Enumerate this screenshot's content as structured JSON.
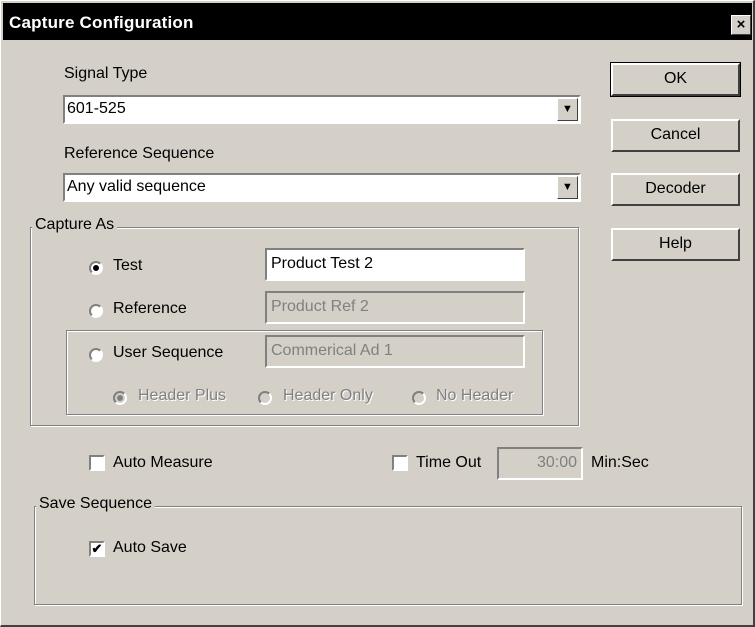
{
  "window": {
    "title": "Capture Configuration",
    "close_glyph": "×"
  },
  "signal_type": {
    "label": "Signal Type",
    "value": "601-525"
  },
  "reference_sequence": {
    "label": "Reference Sequence",
    "value": "Any valid sequence"
  },
  "dropdown_glyph": "▼",
  "buttons": {
    "ok": "OK",
    "cancel": "Cancel",
    "decoder": "Decoder",
    "help": "Help"
  },
  "capture_as": {
    "legend": "Capture As",
    "test": {
      "label": "Test",
      "value": "Product Test 2",
      "selected": true
    },
    "reference": {
      "label": "Reference",
      "value": "Product Ref 2",
      "selected": false
    },
    "user_sequence": {
      "label": "User Sequence",
      "value": "Commerical Ad 1",
      "selected": false
    },
    "header_options": [
      "Header Plus",
      "Header Only",
      "No Header"
    ]
  },
  "auto_measure": {
    "label": "Auto Measure",
    "checked": false
  },
  "time_out": {
    "label": "Time Out",
    "value": "30:00",
    "unit": "Min:Sec",
    "checked": false
  },
  "save_sequence": {
    "legend": "Save Sequence",
    "auto_save": {
      "label": "Auto Save",
      "checked": true,
      "glyph": "✔"
    }
  }
}
